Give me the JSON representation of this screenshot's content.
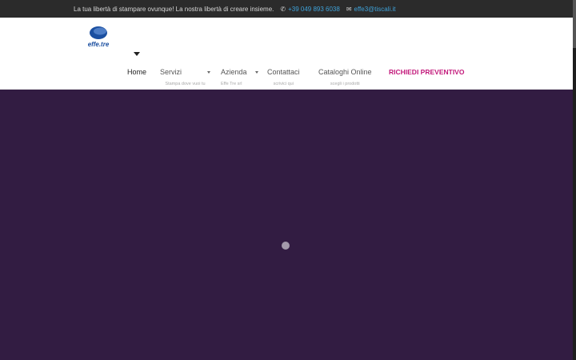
{
  "topbar": {
    "tagline": "La tua libertà di stampare ovunque! La nostra libertà di creare insieme.",
    "phone": "+39 049 893 6038",
    "email": "effe3@tiscali.it"
  },
  "brand": {
    "logo_text": "effe.tre",
    "colors": {
      "accent": "#c2187a",
      "hero": "#321c42",
      "link": "#3fa2d9",
      "logo_blue": "#1b4fa0"
    }
  },
  "nav": {
    "items": [
      {
        "label": "Home",
        "sub": ""
      },
      {
        "label": "Servizi",
        "sub": "Stampa dove vuoi tu"
      },
      {
        "label": "Azienda",
        "sub": "Effe Tre srl"
      },
      {
        "label": "Contattaci",
        "sub": "scrivici qui"
      },
      {
        "label": "Cataloghi Online",
        "sub": "scegli i prodotti"
      },
      {
        "label": "RICHIEDI PREVENTIVO",
        "sub": ""
      }
    ]
  }
}
